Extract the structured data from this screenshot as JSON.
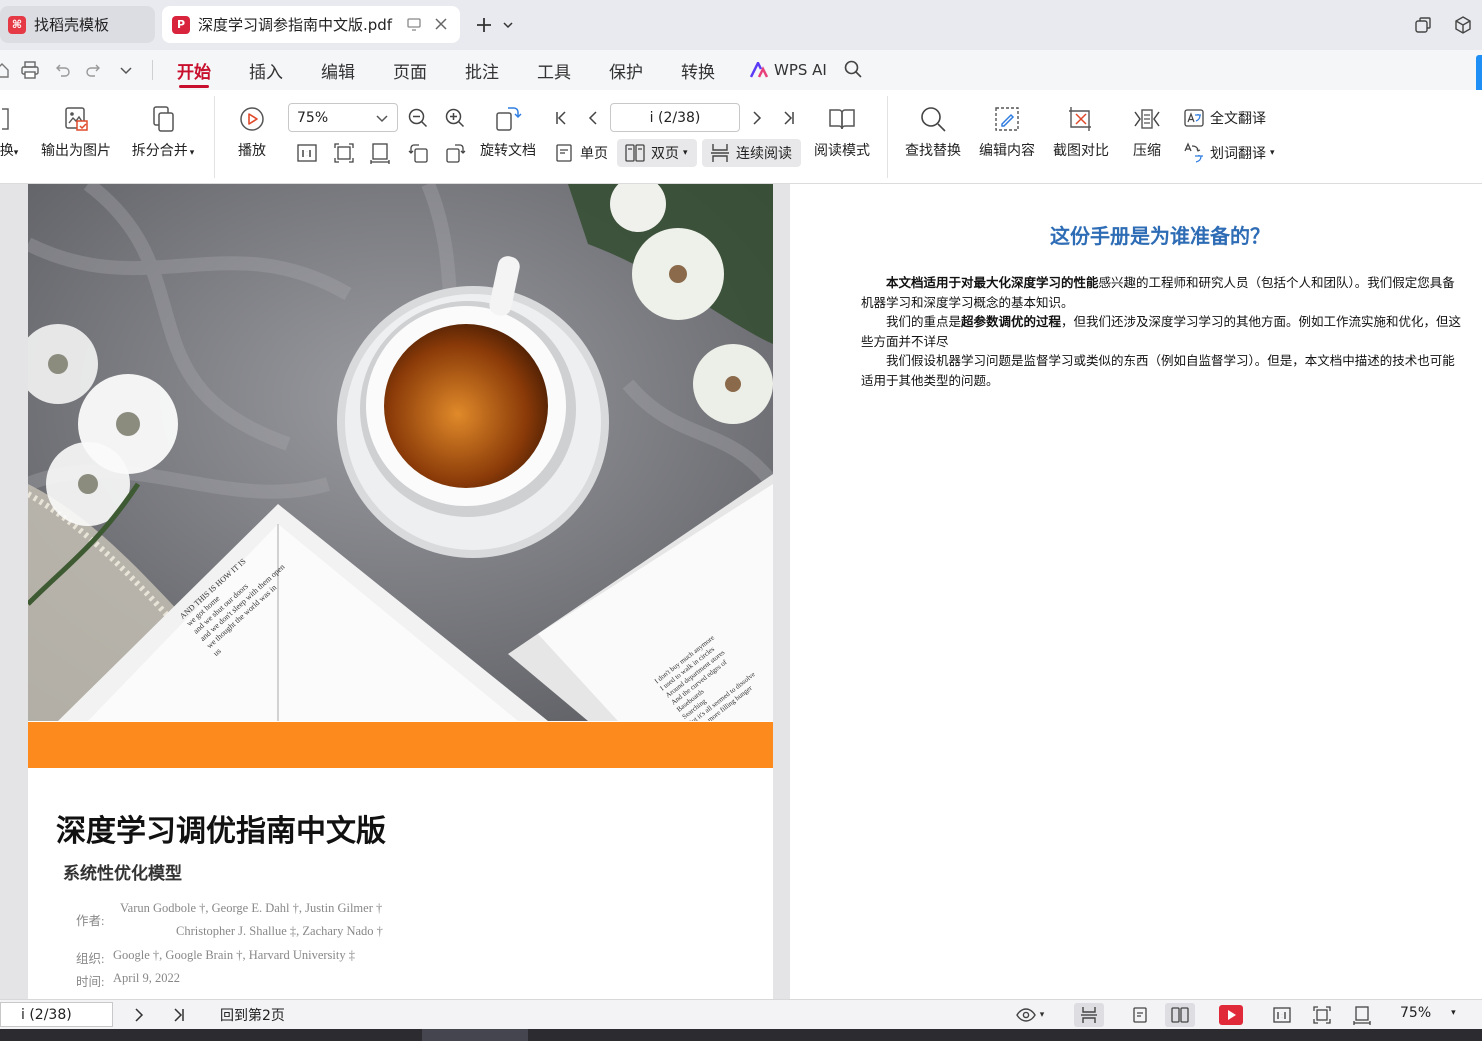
{
  "tabs": [
    {
      "label": "找稻壳模板"
    },
    {
      "label": "深度学习调参指南中文版.pdf"
    }
  ],
  "menu": {
    "items": [
      "开始",
      "插入",
      "编辑",
      "页面",
      "批注",
      "工具",
      "保护",
      "转换"
    ],
    "active": "开始",
    "ai_label": "WPS AI"
  },
  "toolbar": {
    "convert_label": "换",
    "export_image_label": "输出为图片",
    "split_merge_label": "拆分合并",
    "play_label": "播放",
    "zoom_value": "75%",
    "page_value": "i (2/38)",
    "rotate_label": "旋转文档",
    "single_label": "单页",
    "double_label": "双页",
    "continuous_label": "连续阅读",
    "reading_mode_label": "阅读模式",
    "find_replace_label": "查找替换",
    "edit_content_label": "编辑内容",
    "screenshot_compare_label": "截图对比",
    "compress_label": "压缩",
    "full_translate_label": "全文翻译",
    "word_translate_label": "划词翻译"
  },
  "page1": {
    "title": "深度学习调优指南中文版",
    "subtitle": "系统性优化模型",
    "authors_label": "作者:",
    "authors_line1": "Varun Godbole †, George E. Dahl †, Justin Gilmer †",
    "authors_line2": "Christopher J. Shallue ‡, Zachary Nado †",
    "org_label": "组织:",
    "org_value": "Google †, Google Brain †, Harvard University ‡",
    "date_label": "时间:",
    "date_value": "April 9, 2022",
    "book_text_left": "AND THIS IS HOW IT IS\nwe got home\nand we shut our doors\nand we don't sleep with them open\nwe thought the world was in\nus",
    "book_text_right": "I don't buy much anymore\nI used to walk in circles\nAround department stores\nAnd the curved edges of\nBaseboards\nSearching\nBut it's all seemed to dissolve\nInto a more filling hunger"
  },
  "page2": {
    "title": "这份手册是为谁准备的？",
    "p1_bold": "本文档适用于对最大化深度学习的性能",
    "p1_rest": "感兴趣的工程师和研究人员（包括个人和团队）。我们假定您具备机器学习和深度学习概念的基本知识。",
    "p2_pre": "我们的重点是",
    "p2_bold": "超参数调优的过程",
    "p2_rest": "，但我们还涉及深度学习学习的其他方面。例如工作流实施和优化，但这些方面并不详尽",
    "p3": "我们假设机器学习问题是监督学习或类似的东西（例如自监督学习）。但是，本文档中描述的技术也可能适用于其他类型的问题。"
  },
  "status": {
    "page": "i (2/38)",
    "back_label": "回到第2页",
    "zoom": "75%"
  },
  "colors": {
    "accent_red": "#c8102e",
    "orange_band": "#fd8a1d",
    "heading_blue": "#2e6db5"
  }
}
